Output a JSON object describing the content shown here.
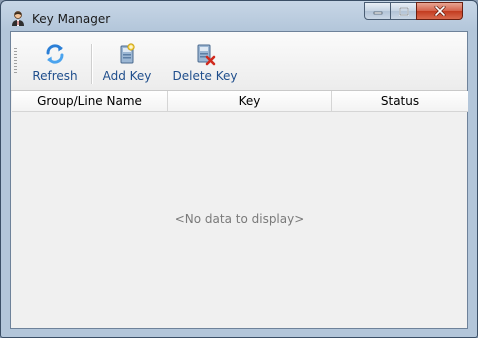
{
  "window": {
    "title": "Key Manager",
    "app_icon": "user-key-icon"
  },
  "caption_buttons": {
    "minimize_icon": "minimize-icon",
    "maximize_icon": "maximize-icon",
    "close_icon": "close-icon"
  },
  "toolbar": {
    "buttons": [
      {
        "label": "Refresh",
        "icon": "refresh-icon"
      },
      {
        "label": "Add Key",
        "icon": "add-key-icon"
      },
      {
        "label": "Delete Key",
        "icon": "delete-key-icon"
      }
    ]
  },
  "grid": {
    "columns": [
      "Group/Line Name",
      "Key",
      "Status"
    ],
    "rows": [],
    "empty_text": "<No data to display>"
  },
  "colors": {
    "toolbar_label": "#1f4e8c",
    "close_button": "#c23b1f"
  }
}
